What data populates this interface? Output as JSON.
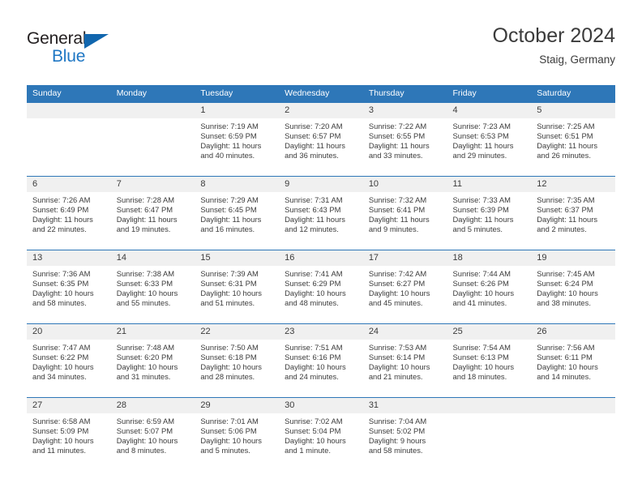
{
  "brand": {
    "name_part1": "General",
    "name_part2": "Blue",
    "logo_icon": "blue-triangle-logo",
    "accent_color": "#1f77c4"
  },
  "header": {
    "title": "October 2024",
    "subtitle": "Staig, Germany"
  },
  "theme": {
    "header_bg": "#2e77b8",
    "daynum_bg": "#f0f0f0",
    "text": "#3b3b3b"
  },
  "calendar": {
    "weekday_headers": [
      "Sunday",
      "Monday",
      "Tuesday",
      "Wednesday",
      "Thursday",
      "Friday",
      "Saturday"
    ],
    "weeks": [
      [
        {
          "day": "",
          "lines": []
        },
        {
          "day": "",
          "lines": []
        },
        {
          "day": "1",
          "lines": [
            "Sunrise: 7:19 AM",
            "Sunset: 6:59 PM",
            "Daylight: 11 hours",
            "and 40 minutes."
          ]
        },
        {
          "day": "2",
          "lines": [
            "Sunrise: 7:20 AM",
            "Sunset: 6:57 PM",
            "Daylight: 11 hours",
            "and 36 minutes."
          ]
        },
        {
          "day": "3",
          "lines": [
            "Sunrise: 7:22 AM",
            "Sunset: 6:55 PM",
            "Daylight: 11 hours",
            "and 33 minutes."
          ]
        },
        {
          "day": "4",
          "lines": [
            "Sunrise: 7:23 AM",
            "Sunset: 6:53 PM",
            "Daylight: 11 hours",
            "and 29 minutes."
          ]
        },
        {
          "day": "5",
          "lines": [
            "Sunrise: 7:25 AM",
            "Sunset: 6:51 PM",
            "Daylight: 11 hours",
            "and 26 minutes."
          ]
        }
      ],
      [
        {
          "day": "6",
          "lines": [
            "Sunrise: 7:26 AM",
            "Sunset: 6:49 PM",
            "Daylight: 11 hours",
            "and 22 minutes."
          ]
        },
        {
          "day": "7",
          "lines": [
            "Sunrise: 7:28 AM",
            "Sunset: 6:47 PM",
            "Daylight: 11 hours",
            "and 19 minutes."
          ]
        },
        {
          "day": "8",
          "lines": [
            "Sunrise: 7:29 AM",
            "Sunset: 6:45 PM",
            "Daylight: 11 hours",
            "and 16 minutes."
          ]
        },
        {
          "day": "9",
          "lines": [
            "Sunrise: 7:31 AM",
            "Sunset: 6:43 PM",
            "Daylight: 11 hours",
            "and 12 minutes."
          ]
        },
        {
          "day": "10",
          "lines": [
            "Sunrise: 7:32 AM",
            "Sunset: 6:41 PM",
            "Daylight: 11 hours",
            "and 9 minutes."
          ]
        },
        {
          "day": "11",
          "lines": [
            "Sunrise: 7:33 AM",
            "Sunset: 6:39 PM",
            "Daylight: 11 hours",
            "and 5 minutes."
          ]
        },
        {
          "day": "12",
          "lines": [
            "Sunrise: 7:35 AM",
            "Sunset: 6:37 PM",
            "Daylight: 11 hours",
            "and 2 minutes."
          ]
        }
      ],
      [
        {
          "day": "13",
          "lines": [
            "Sunrise: 7:36 AM",
            "Sunset: 6:35 PM",
            "Daylight: 10 hours",
            "and 58 minutes."
          ]
        },
        {
          "day": "14",
          "lines": [
            "Sunrise: 7:38 AM",
            "Sunset: 6:33 PM",
            "Daylight: 10 hours",
            "and 55 minutes."
          ]
        },
        {
          "day": "15",
          "lines": [
            "Sunrise: 7:39 AM",
            "Sunset: 6:31 PM",
            "Daylight: 10 hours",
            "and 51 minutes."
          ]
        },
        {
          "day": "16",
          "lines": [
            "Sunrise: 7:41 AM",
            "Sunset: 6:29 PM",
            "Daylight: 10 hours",
            "and 48 minutes."
          ]
        },
        {
          "day": "17",
          "lines": [
            "Sunrise: 7:42 AM",
            "Sunset: 6:27 PM",
            "Daylight: 10 hours",
            "and 45 minutes."
          ]
        },
        {
          "day": "18",
          "lines": [
            "Sunrise: 7:44 AM",
            "Sunset: 6:26 PM",
            "Daylight: 10 hours",
            "and 41 minutes."
          ]
        },
        {
          "day": "19",
          "lines": [
            "Sunrise: 7:45 AM",
            "Sunset: 6:24 PM",
            "Daylight: 10 hours",
            "and 38 minutes."
          ]
        }
      ],
      [
        {
          "day": "20",
          "lines": [
            "Sunrise: 7:47 AM",
            "Sunset: 6:22 PM",
            "Daylight: 10 hours",
            "and 34 minutes."
          ]
        },
        {
          "day": "21",
          "lines": [
            "Sunrise: 7:48 AM",
            "Sunset: 6:20 PM",
            "Daylight: 10 hours",
            "and 31 minutes."
          ]
        },
        {
          "day": "22",
          "lines": [
            "Sunrise: 7:50 AM",
            "Sunset: 6:18 PM",
            "Daylight: 10 hours",
            "and 28 minutes."
          ]
        },
        {
          "day": "23",
          "lines": [
            "Sunrise: 7:51 AM",
            "Sunset: 6:16 PM",
            "Daylight: 10 hours",
            "and 24 minutes."
          ]
        },
        {
          "day": "24",
          "lines": [
            "Sunrise: 7:53 AM",
            "Sunset: 6:14 PM",
            "Daylight: 10 hours",
            "and 21 minutes."
          ]
        },
        {
          "day": "25",
          "lines": [
            "Sunrise: 7:54 AM",
            "Sunset: 6:13 PM",
            "Daylight: 10 hours",
            "and 18 minutes."
          ]
        },
        {
          "day": "26",
          "lines": [
            "Sunrise: 7:56 AM",
            "Sunset: 6:11 PM",
            "Daylight: 10 hours",
            "and 14 minutes."
          ]
        }
      ],
      [
        {
          "day": "27",
          "lines": [
            "Sunrise: 6:58 AM",
            "Sunset: 5:09 PM",
            "Daylight: 10 hours",
            "and 11 minutes."
          ]
        },
        {
          "day": "28",
          "lines": [
            "Sunrise: 6:59 AM",
            "Sunset: 5:07 PM",
            "Daylight: 10 hours",
            "and 8 minutes."
          ]
        },
        {
          "day": "29",
          "lines": [
            "Sunrise: 7:01 AM",
            "Sunset: 5:06 PM",
            "Daylight: 10 hours",
            "and 5 minutes."
          ]
        },
        {
          "day": "30",
          "lines": [
            "Sunrise: 7:02 AM",
            "Sunset: 5:04 PM",
            "Daylight: 10 hours",
            "and 1 minute."
          ]
        },
        {
          "day": "31",
          "lines": [
            "Sunrise: 7:04 AM",
            "Sunset: 5:02 PM",
            "Daylight: 9 hours",
            "and 58 minutes."
          ]
        },
        {
          "day": "",
          "lines": []
        },
        {
          "day": "",
          "lines": []
        }
      ]
    ]
  }
}
